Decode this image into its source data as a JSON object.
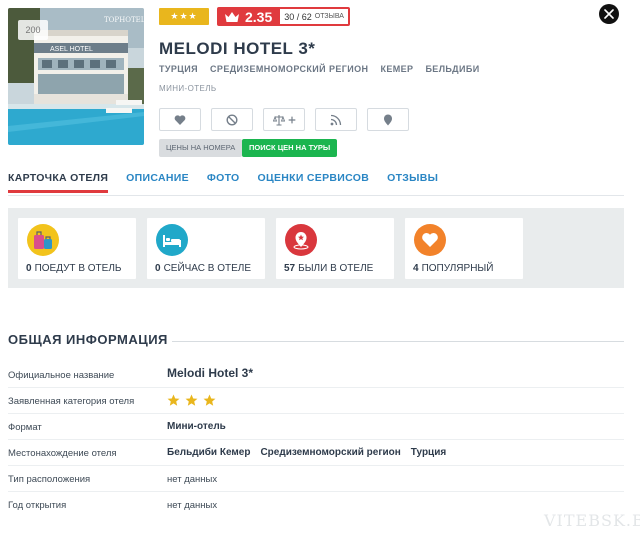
{
  "hotel": {
    "photo_count": "200",
    "photo_sign": "ASEL HOTEL",
    "photo_logo": "TOPHOTELS",
    "stars_badge": "★★★",
    "rating": "2.35",
    "rank": "30 / 62",
    "rank_suffix": "отзыва",
    "title": "MELODI HOTEL 3*",
    "location": [
      "Турция",
      "Средиземноморский регион",
      "Кемер",
      "Бельдиби"
    ],
    "type": "Мини-отель",
    "price_rooms": "Цены на номера",
    "price_tours": "Поиск цен на туры"
  },
  "actions": [
    "heart-icon",
    "block-icon",
    "compare-icon",
    "rss-icon",
    "map-pin-icon"
  ],
  "tabs": [
    "Карточка отеля",
    "Описание",
    "Фото",
    "Оценки сервисов",
    "Отзывы"
  ],
  "stats": [
    {
      "count": "0",
      "label": "поедут в отель",
      "icon": "luggage-icon",
      "color": "#f2c31c"
    },
    {
      "count": "0",
      "label": "сейчас в отеле",
      "icon": "bed-icon",
      "color": "#20a8c9"
    },
    {
      "count": "57",
      "label": "были в отеле",
      "icon": "map-pin-star-icon",
      "color": "#d9373d"
    },
    {
      "count": "4",
      "label": "популярный",
      "icon": "heart-icon",
      "color": "#f2822a"
    }
  ],
  "general": {
    "title": "Общая информация",
    "rows": {
      "official_name": {
        "label": "Официальное название",
        "value": "Melodi Hotel 3*"
      },
      "category": {
        "label": "Заявленная категория отеля",
        "stars": 3
      },
      "format": {
        "label": "Формат",
        "value": "Мини-отель"
      },
      "location": {
        "label": "Местонахождение отеля",
        "parts": [
          "Бельдиби Кемер",
          "Средиземноморский регион",
          "Турция"
        ]
      },
      "placement": {
        "label": "Тип расположения",
        "value": "нет данных"
      },
      "opened": {
        "label": "Год открытия",
        "value": "нет данных"
      }
    }
  },
  "watermark": "VITEBSK.BIZ",
  "colors": {
    "accent_red": "#e03a3e",
    "link_blue": "#2a86c4",
    "star_yellow": "#e9b61d",
    "green": "#1bb54f"
  }
}
